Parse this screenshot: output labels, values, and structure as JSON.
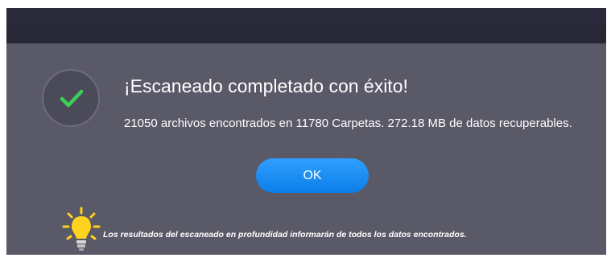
{
  "dialog": {
    "title": "¡Escaneado completado con éxito!",
    "description": "21050 archivos encontrados en 11780 Carpetas. 272.18 MB de datos recuperables.",
    "ok_label": "OK",
    "tip": "Los resultados del escaneado en profundidad informarán de todos los datos encontrados."
  },
  "icons": {
    "status": "checkmark-icon",
    "tip": "lightbulb-icon"
  },
  "colors": {
    "background": "#5a5968",
    "topbar": "#2b2b3c",
    "accent_button": "#1a8cff",
    "check": "#3ccf5a",
    "bulb": "#ffd21f"
  }
}
